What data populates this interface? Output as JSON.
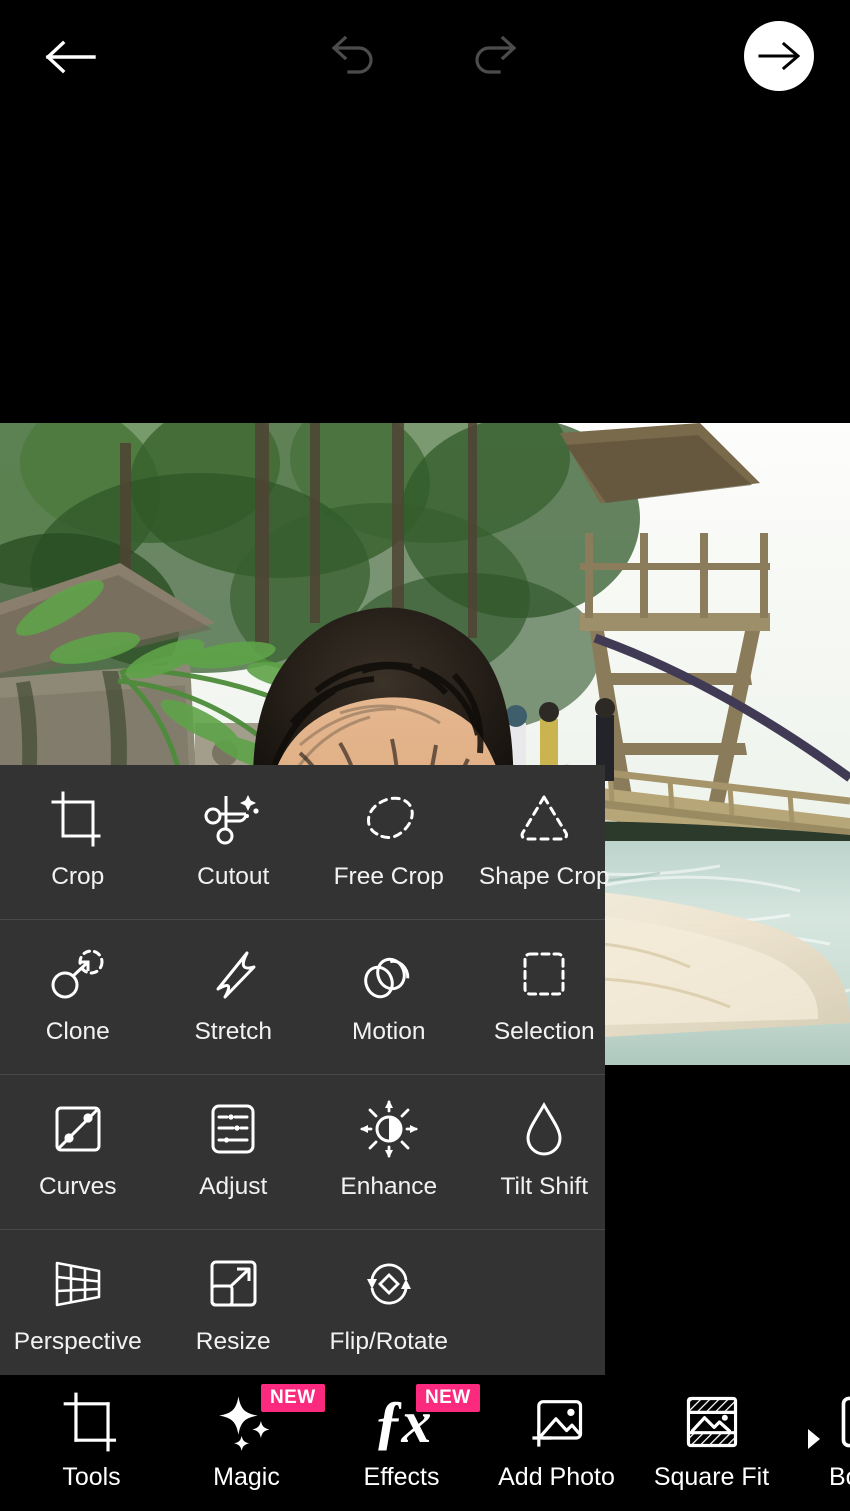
{
  "app": {
    "screen_name": "photo-editor",
    "background_color": "#000000",
    "panel_color": "#333333",
    "accent_badge_color": "#FC2A7F"
  },
  "topbar": {
    "back_label": "Back",
    "undo_label": "Undo",
    "redo_label": "Redo",
    "apply_label": "Apply",
    "undo_enabled": false,
    "redo_enabled": false
  },
  "canvas": {
    "photo_description": "Selfie of a person partially submerged in a green river with trees, stone wall, ferns and a bamboo bridge tower in the background"
  },
  "tools_panel": {
    "rows": [
      [
        {
          "label": "Crop",
          "icon": "crop-icon"
        },
        {
          "label": "Cutout",
          "icon": "scissors-sparkle-icon"
        },
        {
          "label": "Free Crop",
          "icon": "dashed-blob-icon"
        },
        {
          "label": "Shape Crop",
          "icon": "dashed-triangle-icon"
        }
      ],
      [
        {
          "label": "Clone",
          "icon": "clone-stamp-icon"
        },
        {
          "label": "Stretch",
          "icon": "stretch-icon"
        },
        {
          "label": "Motion",
          "icon": "motion-circles-icon"
        },
        {
          "label": "Selection",
          "icon": "dashed-rect-icon"
        }
      ],
      [
        {
          "label": "Curves",
          "icon": "curves-icon"
        },
        {
          "label": "Adjust",
          "icon": "sliders-icon"
        },
        {
          "label": "Enhance",
          "icon": "brightness-icon"
        },
        {
          "label": "Tilt Shift",
          "icon": "droplet-icon"
        }
      ],
      [
        {
          "label": "Perspective",
          "icon": "perspective-grid-icon"
        },
        {
          "label": "Resize",
          "icon": "resize-icon"
        },
        {
          "label": "Flip/Rotate",
          "icon": "flip-rotate-icon"
        },
        {
          "label": "",
          "icon": ""
        }
      ]
    ]
  },
  "bottom_nav": {
    "items": [
      {
        "label": "Tools",
        "icon": "crop-icon",
        "badge": "",
        "active": true
      },
      {
        "label": "Magic",
        "icon": "sparkles-icon",
        "badge": "NEW",
        "active": false
      },
      {
        "label": "Effects",
        "icon": "fx-icon",
        "badge": "NEW",
        "active": false
      },
      {
        "label": "Add Photo",
        "icon": "add-photo-icon",
        "badge": "",
        "active": false
      },
      {
        "label": "Square Fit",
        "icon": "square-fit-icon",
        "badge": "",
        "active": false
      },
      {
        "label": "Border",
        "icon": "border-icon",
        "badge": "",
        "active": false
      }
    ],
    "scroll_arrow": "chevron-right-icon"
  }
}
